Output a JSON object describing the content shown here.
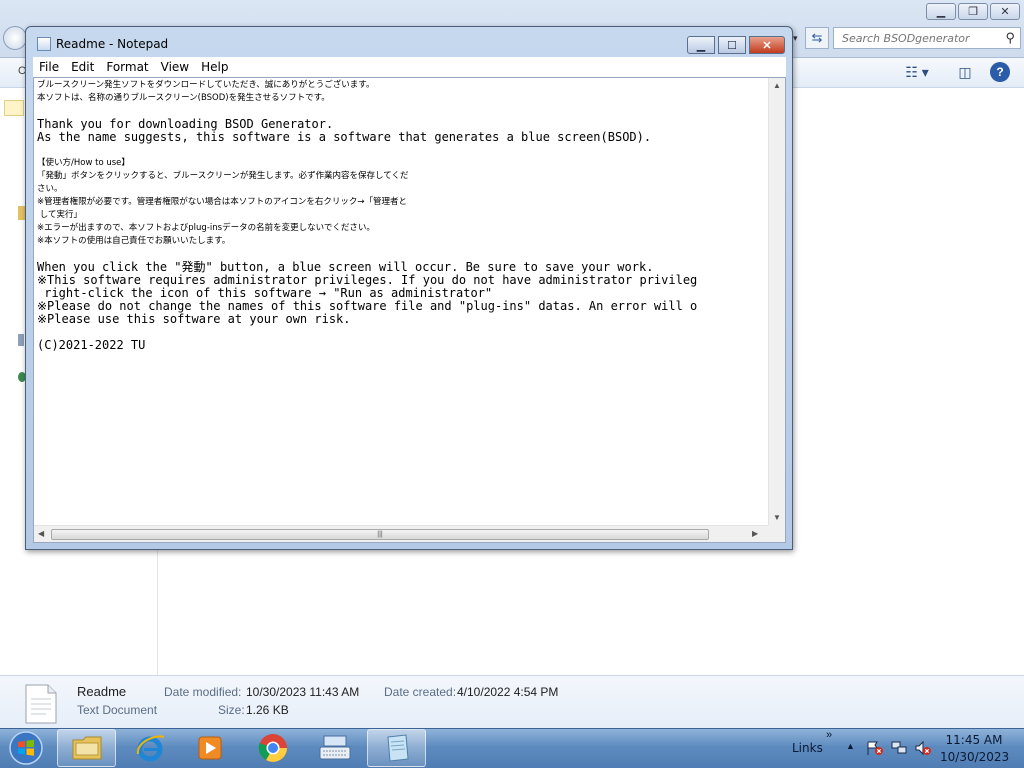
{
  "explorer": {
    "search_placeholder": "Search BSODgenerator",
    "organize_fragment": "O"
  },
  "notepad": {
    "title": "Readme - Notepad",
    "menu": [
      "File",
      "Edit",
      "Format",
      "View",
      "Help"
    ],
    "lines": [
      "ブルースクリーン発生ソフトをダウンロードしていただき、誠にありがとうございます。",
      "本ソフトは、名称の通りブルースクリーン(BSOD)を発生させるソフトです。",
      "",
      "Thank you for downloading BSOD Generator.",
      "As the name suggests, this software is a software that generates a blue screen(BSOD).",
      "",
      "【使い方/How to use】",
      "「発動」ボタンをクリックすると、ブルースクリーンが発生します。必ず作業内容を保存してくだ",
      "さい。",
      "※管理者権限が必要です。管理者権限がない場合は本ソフトのアイコンを右クリック→「管理者と",
      " して実行」",
      "※エラーが出ますので、本ソフトおよびplug-insデータの名前を変更しないでください。",
      "※本ソフトの使用は自己責任でお願いいたします。",
      "",
      "When you click the \"発動\" button, a blue screen will occur. Be sure to save your work.",
      "※This software requires administrator privileges. If you do not have administrator privileg",
      " right-click the icon of this software → \"Run as administrator\"",
      "※Please do not change the names of this software file and \"plug-ins\" datas. An error will o",
      "※Please use this software at your own risk.",
      "",
      "(C)2021-2022 TU"
    ],
    "small_lines": [
      0,
      1,
      6,
      7,
      8,
      9,
      10,
      11,
      12
    ]
  },
  "details": {
    "file_name": "Readme",
    "file_type": "Text Document",
    "modified_label": "Date modified:",
    "modified_value": "10/30/2023 11:43 AM",
    "created_label": "Date created:",
    "created_value": "4/10/2022 4:54 PM",
    "size_label": "Size:",
    "size_value": "1.26 KB"
  },
  "taskbar": {
    "apps": [
      "explorer",
      "internet-explorer",
      "media-player",
      "chrome",
      "virtual-keyboard",
      "notepad"
    ],
    "links_label": "Links",
    "links_chevron": "»",
    "time": "11:45 AM",
    "date": "10/30/2023"
  },
  "colors": {
    "taskbar": "#5e8bbf",
    "window_frame": "#b3c9e6",
    "close_button": "#c13b1f"
  }
}
